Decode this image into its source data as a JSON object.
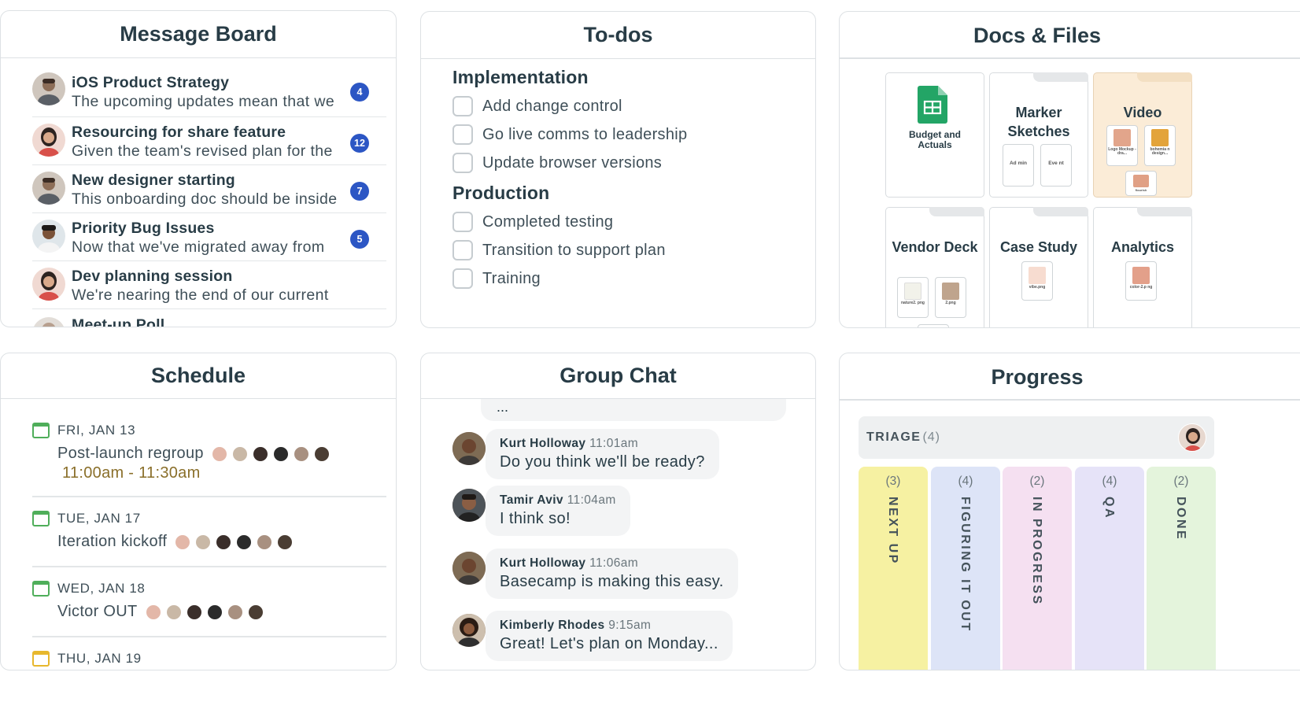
{
  "message_board": {
    "title": "Message Board",
    "messages": [
      {
        "title": "iOS Product Strategy",
        "excerpt": "The upcoming updates mean that we",
        "count": "4"
      },
      {
        "title": "Resourcing for share feature",
        "excerpt": "Given the team's revised plan for the",
        "count": "12"
      },
      {
        "title": "New designer starting",
        "excerpt": "This onboarding doc should be inside",
        "count": "7"
      },
      {
        "title": "Priority Bug Issues",
        "excerpt": "Now that we've migrated away from",
        "count": "5"
      },
      {
        "title": "Dev planning session",
        "excerpt": "We're nearing the end of our current",
        "count": ""
      },
      {
        "title": "Meet-up Poll",
        "excerpt": "",
        "count": ""
      }
    ]
  },
  "todos": {
    "title": "To-dos",
    "groups": [
      {
        "name": "Implementation",
        "items": [
          "Add change control",
          "Go live comms to leadership",
          "Update browser versions"
        ]
      },
      {
        "name": "Production",
        "items": [
          "Completed testing",
          "Transition to support plan",
          "Training"
        ]
      }
    ]
  },
  "docs": {
    "title": "Docs & Files",
    "items": [
      {
        "name": "Budget and Actuals",
        "icon": "spreadsheet-icon"
      },
      {
        "name": "Marker Sketches",
        "thumbs": [
          "Ad min",
          "Eve nt"
        ]
      },
      {
        "name": "Video",
        "thumbs": [
          "Logo Mockup - dra...",
          "bohemia n design...",
          "flourish"
        ]
      },
      {
        "name": "Vendor Deck",
        "thumbs": [
          "nature2. png",
          "2.png"
        ]
      },
      {
        "name": "Case Study",
        "thumbs": [
          "vibe.png"
        ]
      },
      {
        "name": "Analytics",
        "thumbs": [
          "color-2.p ng"
        ]
      }
    ]
  },
  "schedule": {
    "title": "Schedule",
    "events": [
      {
        "date": "FRI, JAN 13",
        "title": "Post-launch regroup",
        "time": "11:00am - 11:30am"
      },
      {
        "date": "TUE, JAN 17",
        "title": "Iteration kickoff",
        "time": ""
      },
      {
        "date": "WED, JAN 18",
        "title": "Victor OUT",
        "time": ""
      },
      {
        "date": "THU, JAN 19",
        "title": "",
        "time": ""
      }
    ]
  },
  "chat": {
    "title": "Group Chat",
    "truncated": "...",
    "messages": [
      {
        "author": "Kurt Holloway",
        "time": "11:01am",
        "text": "Do you think we'll be ready?"
      },
      {
        "author": "Tamir Aviv",
        "time": "11:04am",
        "text": "I think so!"
      },
      {
        "author": "Kurt Holloway",
        "time": "11:06am",
        "text": "Basecamp is making this easy."
      },
      {
        "author": "Kimberly Rhodes",
        "time": "9:15am",
        "text": "Great! Let's plan on Monday..."
      }
    ]
  },
  "progress": {
    "title": "Progress",
    "triage_label": "TRIAGE",
    "triage_count": "(4)",
    "columns": [
      {
        "count": "(3)",
        "name": "NEXT UP",
        "color": "#f6f1a2"
      },
      {
        "count": "(4)",
        "name": "FIGURING IT OUT",
        "color": "#dde4f7"
      },
      {
        "count": "(2)",
        "name": "IN PROGRESS",
        "color": "#f5e0f1"
      },
      {
        "count": "(4)",
        "name": "QA",
        "color": "#e6e3f8"
      },
      {
        "count": "(2)",
        "name": "DONE",
        "color": "#e4f4dc"
      }
    ]
  },
  "colors": {
    "badge": "#2c56c4",
    "calendar_green": "#4fae5a",
    "calendar_yellow": "#e7b72d",
    "time_text": "#8a6f2a"
  }
}
